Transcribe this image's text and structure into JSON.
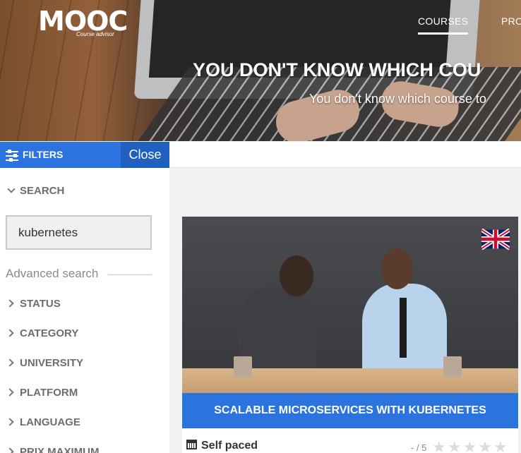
{
  "header": {
    "logo_text": "MOOC",
    "logo_subtitle": "Course advisor",
    "nav": [
      {
        "label": "COURSES",
        "active": true
      },
      {
        "label": "PRO",
        "active": false
      }
    ],
    "hero_title": "YOU DON'T KNOW WHICH COU",
    "hero_subtitle": "You don't know which course to"
  },
  "filters": {
    "title": "FILTERS",
    "close_label": "Close",
    "search_label": "SEARCH",
    "search_value": "kubernetes",
    "advanced_label": "Advanced search",
    "items": [
      "STATUS",
      "CATEGORY",
      "UNIVERSITY",
      "PLATFORM",
      "LANGUAGE",
      "PRIX MAXIMUM"
    ]
  },
  "course": {
    "title": "SCALABLE MICROSERVICES WITH KUBERNETES",
    "language_flag": "uk-flag-icon",
    "pace": "Self paced",
    "rating_text": "- / 5",
    "stars": "★★★★★"
  },
  "colors": {
    "accent": "#2b74e0",
    "accent_dark": "#1f5fbf"
  }
}
